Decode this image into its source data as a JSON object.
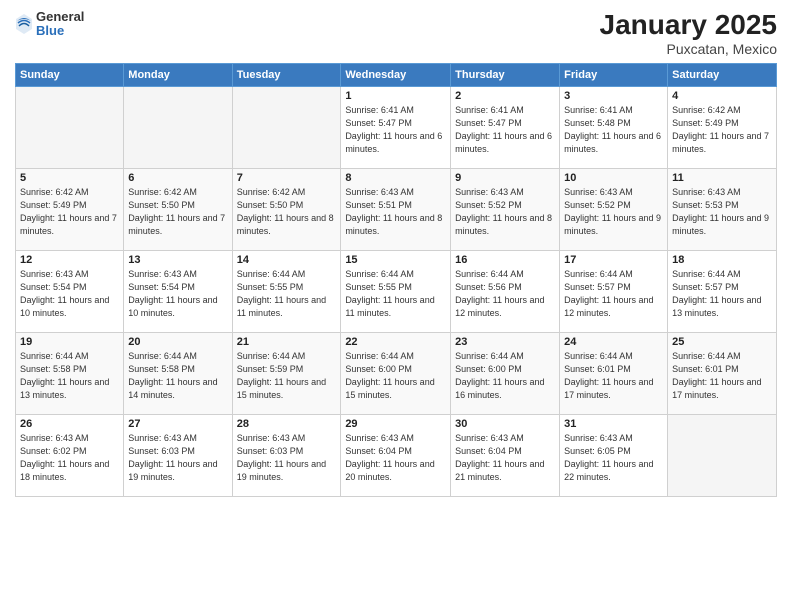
{
  "header": {
    "logo_general": "General",
    "logo_blue": "Blue",
    "title": "January 2025",
    "subtitle": "Puxcatan, Mexico"
  },
  "weekdays": [
    "Sunday",
    "Monday",
    "Tuesday",
    "Wednesday",
    "Thursday",
    "Friday",
    "Saturday"
  ],
  "weeks": [
    [
      {
        "day": "",
        "info": ""
      },
      {
        "day": "",
        "info": ""
      },
      {
        "day": "",
        "info": ""
      },
      {
        "day": "1",
        "info": "Sunrise: 6:41 AM\nSunset: 5:47 PM\nDaylight: 11 hours and 6 minutes."
      },
      {
        "day": "2",
        "info": "Sunrise: 6:41 AM\nSunset: 5:47 PM\nDaylight: 11 hours and 6 minutes."
      },
      {
        "day": "3",
        "info": "Sunrise: 6:41 AM\nSunset: 5:48 PM\nDaylight: 11 hours and 6 minutes."
      },
      {
        "day": "4",
        "info": "Sunrise: 6:42 AM\nSunset: 5:49 PM\nDaylight: 11 hours and 7 minutes."
      }
    ],
    [
      {
        "day": "5",
        "info": "Sunrise: 6:42 AM\nSunset: 5:49 PM\nDaylight: 11 hours and 7 minutes."
      },
      {
        "day": "6",
        "info": "Sunrise: 6:42 AM\nSunset: 5:50 PM\nDaylight: 11 hours and 7 minutes."
      },
      {
        "day": "7",
        "info": "Sunrise: 6:42 AM\nSunset: 5:50 PM\nDaylight: 11 hours and 8 minutes."
      },
      {
        "day": "8",
        "info": "Sunrise: 6:43 AM\nSunset: 5:51 PM\nDaylight: 11 hours and 8 minutes."
      },
      {
        "day": "9",
        "info": "Sunrise: 6:43 AM\nSunset: 5:52 PM\nDaylight: 11 hours and 8 minutes."
      },
      {
        "day": "10",
        "info": "Sunrise: 6:43 AM\nSunset: 5:52 PM\nDaylight: 11 hours and 9 minutes."
      },
      {
        "day": "11",
        "info": "Sunrise: 6:43 AM\nSunset: 5:53 PM\nDaylight: 11 hours and 9 minutes."
      }
    ],
    [
      {
        "day": "12",
        "info": "Sunrise: 6:43 AM\nSunset: 5:54 PM\nDaylight: 11 hours and 10 minutes."
      },
      {
        "day": "13",
        "info": "Sunrise: 6:43 AM\nSunset: 5:54 PM\nDaylight: 11 hours and 10 minutes."
      },
      {
        "day": "14",
        "info": "Sunrise: 6:44 AM\nSunset: 5:55 PM\nDaylight: 11 hours and 11 minutes."
      },
      {
        "day": "15",
        "info": "Sunrise: 6:44 AM\nSunset: 5:55 PM\nDaylight: 11 hours and 11 minutes."
      },
      {
        "day": "16",
        "info": "Sunrise: 6:44 AM\nSunset: 5:56 PM\nDaylight: 11 hours and 12 minutes."
      },
      {
        "day": "17",
        "info": "Sunrise: 6:44 AM\nSunset: 5:57 PM\nDaylight: 11 hours and 12 minutes."
      },
      {
        "day": "18",
        "info": "Sunrise: 6:44 AM\nSunset: 5:57 PM\nDaylight: 11 hours and 13 minutes."
      }
    ],
    [
      {
        "day": "19",
        "info": "Sunrise: 6:44 AM\nSunset: 5:58 PM\nDaylight: 11 hours and 13 minutes."
      },
      {
        "day": "20",
        "info": "Sunrise: 6:44 AM\nSunset: 5:58 PM\nDaylight: 11 hours and 14 minutes."
      },
      {
        "day": "21",
        "info": "Sunrise: 6:44 AM\nSunset: 5:59 PM\nDaylight: 11 hours and 15 minutes."
      },
      {
        "day": "22",
        "info": "Sunrise: 6:44 AM\nSunset: 6:00 PM\nDaylight: 11 hours and 15 minutes."
      },
      {
        "day": "23",
        "info": "Sunrise: 6:44 AM\nSunset: 6:00 PM\nDaylight: 11 hours and 16 minutes."
      },
      {
        "day": "24",
        "info": "Sunrise: 6:44 AM\nSunset: 6:01 PM\nDaylight: 11 hours and 17 minutes."
      },
      {
        "day": "25",
        "info": "Sunrise: 6:44 AM\nSunset: 6:01 PM\nDaylight: 11 hours and 17 minutes."
      }
    ],
    [
      {
        "day": "26",
        "info": "Sunrise: 6:43 AM\nSunset: 6:02 PM\nDaylight: 11 hours and 18 minutes."
      },
      {
        "day": "27",
        "info": "Sunrise: 6:43 AM\nSunset: 6:03 PM\nDaylight: 11 hours and 19 minutes."
      },
      {
        "day": "28",
        "info": "Sunrise: 6:43 AM\nSunset: 6:03 PM\nDaylight: 11 hours and 19 minutes."
      },
      {
        "day": "29",
        "info": "Sunrise: 6:43 AM\nSunset: 6:04 PM\nDaylight: 11 hours and 20 minutes."
      },
      {
        "day": "30",
        "info": "Sunrise: 6:43 AM\nSunset: 6:04 PM\nDaylight: 11 hours and 21 minutes."
      },
      {
        "day": "31",
        "info": "Sunrise: 6:43 AM\nSunset: 6:05 PM\nDaylight: 11 hours and 22 minutes."
      },
      {
        "day": "",
        "info": ""
      }
    ]
  ]
}
